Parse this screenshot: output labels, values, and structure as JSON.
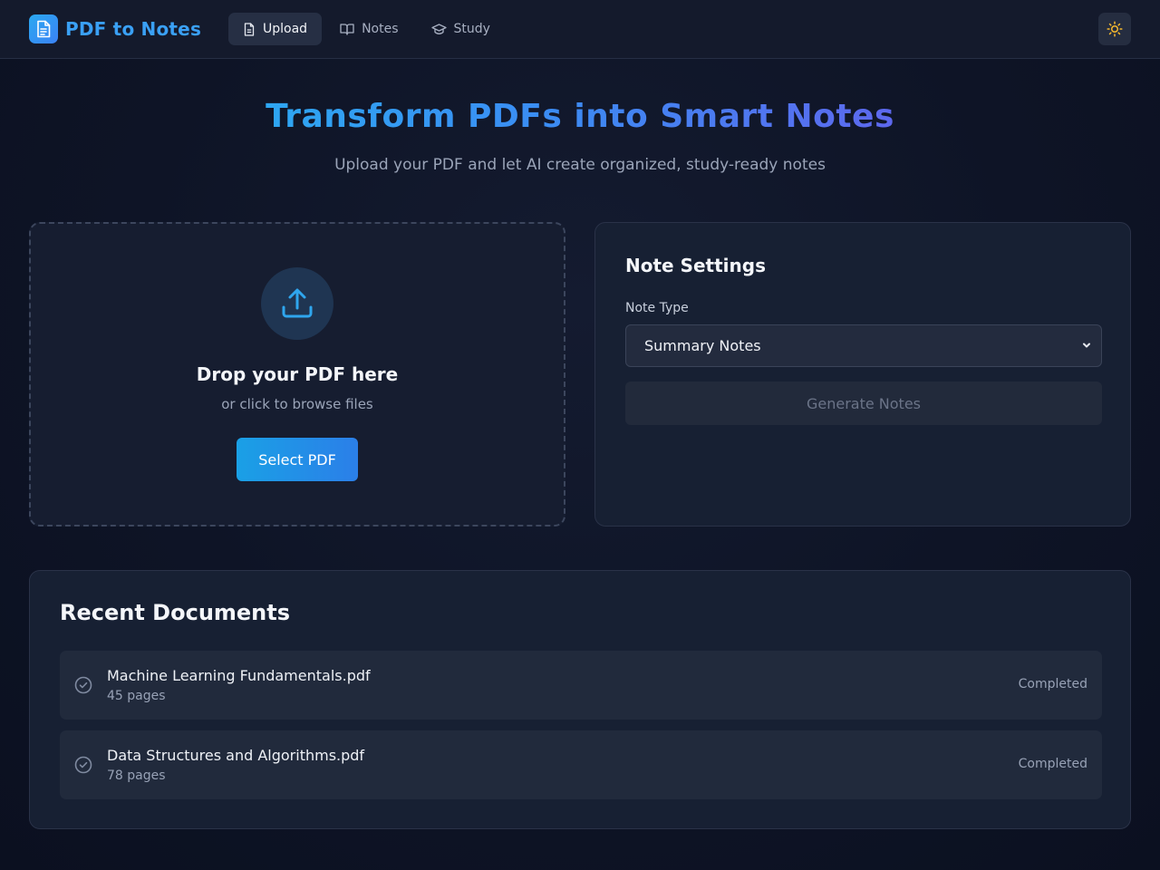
{
  "app": {
    "name": "PDF to Notes"
  },
  "nav": {
    "tabs": [
      {
        "label": "Upload",
        "icon": "file-icon",
        "active": true
      },
      {
        "label": "Notes",
        "icon": "book-open-icon",
        "active": false
      },
      {
        "label": "Study",
        "icon": "graduation-cap-icon",
        "active": false
      }
    ],
    "theme_toggle_icon": "sun-icon"
  },
  "hero": {
    "title": "Transform PDFs into Smart Notes",
    "subtitle": "Upload your PDF and let AI create organized, study-ready notes"
  },
  "upload": {
    "icon": "upload-icon",
    "title": "Drop your PDF here",
    "subtitle": "or click to browse files",
    "button_label": "Select PDF"
  },
  "settings": {
    "title": "Note Settings",
    "note_type_label": "Note Type",
    "note_type_value": "Summary Notes",
    "generate_label": "Generate Notes"
  },
  "recent": {
    "title": "Recent Documents",
    "documents": [
      {
        "name": "Machine Learning Fundamentals.pdf",
        "pages": "45 pages",
        "status": "Completed"
      },
      {
        "name": "Data Structures and Algorithms.pdf",
        "pages": "78 pages",
        "status": "Completed"
      }
    ]
  },
  "colors": {
    "accent": "#3b82f6",
    "sun": "#f5b82e",
    "background": "#0e1426"
  }
}
